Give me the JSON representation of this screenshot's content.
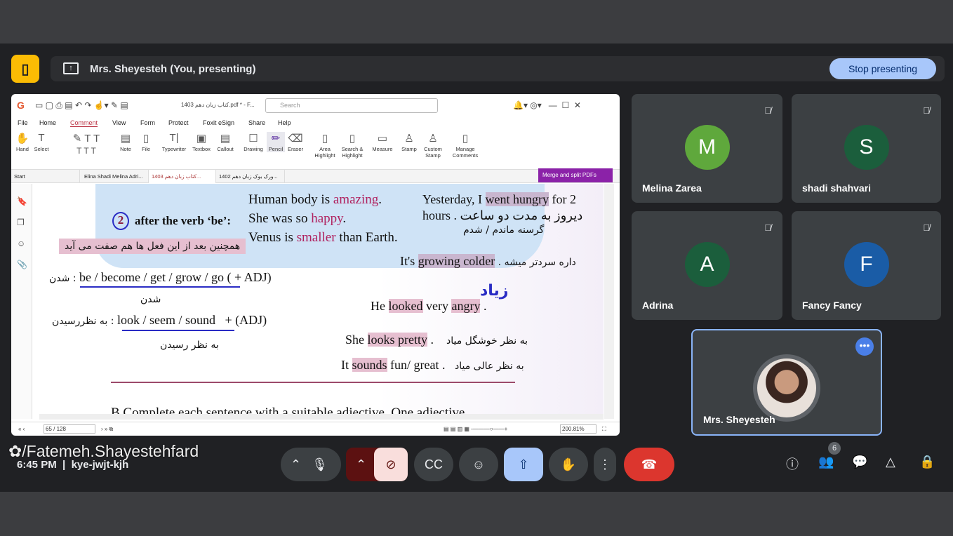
{
  "meeting": {
    "presenter_text": "Mrs. Sheyesteh (You, presenting)",
    "stop_label": "Stop presenting",
    "time": "6:45 PM",
    "code": "kye-jwjt-kjh",
    "watermark": "/Fatemeh.Shayestehfard",
    "participant_count": "6"
  },
  "pdf": {
    "title": "کتاب زبان دهم 1403.pdf * - F...",
    "search_placeholder": "Search",
    "menu": [
      "File",
      "Home",
      "Comment",
      "View",
      "Form",
      "Protect",
      "Foxit eSign",
      "Share",
      "Help"
    ],
    "tools": [
      "Hand",
      "Select",
      "Note",
      "File",
      "Typewriter",
      "Textbox",
      "Callout",
      "Drawing",
      "Pencil",
      "Eraser",
      "Area Highlight",
      "Search & Highlight",
      "Measure",
      "Stamp",
      "Custom Stamp",
      "Manage Comments"
    ],
    "tabs": [
      "Start",
      "Elina Shadi Melina Adri...",
      "کتاب زبان دهم 1403...",
      "ورک بوک زبان دهم 1402..."
    ],
    "merge_label": "Merge and split PDFs",
    "page": "65 / 128",
    "zoom": "200.81%",
    "content": {
      "heading": "after the verb ‘be’:",
      "num": "2",
      "l1a": "Human body is ",
      "l1b": "amazing",
      "l2a": "She was so ",
      "l2b": "happy",
      "l3a": "Venus is ",
      "l3b": "smaller",
      "l3c": " than Earth.",
      "fa_note": "همچنین بعد از این فعل ها هم صفت می آید",
      "r1a": "Yesterday, I ",
      "r1b": "went hungry",
      "r1c": " for 2",
      "r2": "hours .  دیروز به مدت دو ساعت",
      "r3": "گرسنه ماندم / شدم",
      "r4a": "It's ",
      "r4b": "growing colder",
      "r4c": " .  داره سردتر میشه",
      "verbs1": "be / become / get / grow / go",
      "verbs1_tail": "( + ADJ)",
      "verbs1_fa": "شدن :",
      "verbs1_under": "شدن",
      "verbs2": "look / seem / sound",
      "verbs2_tail": "+ (ADJ)",
      "verbs2_fa": "به نظررسیدن :",
      "verbs2_under": "به نظر رسیدن",
      "ex1a": "He ",
      "ex1b": "looked",
      "ex1c": " very ",
      "ex1d": "angry",
      "ex1e": " .",
      "ex2a": "She ",
      "ex2b": "looks pretty",
      "ex2c": " .",
      "ex2fa": "به نظر خوشگل میاد",
      "ex3a": "It ",
      "ex3b": "sounds",
      "ex3c": " fun/ great .",
      "ex3fa": "به نظر عالی میاد",
      "ink_word": "زیاد",
      "bottom": "B  Complete each sentence with a suitable adjective.  One adjective"
    }
  },
  "participants": [
    {
      "name": "Melina Zarea",
      "initial": "M",
      "color": "#5fa83c"
    },
    {
      "name": "shadi shahvari",
      "initial": "S",
      "color": "#1b5e3c"
    },
    {
      "name": "Adrina",
      "initial": "A",
      "color": "#1b5e3c"
    },
    {
      "name": "Fancy Fancy",
      "initial": "F",
      "color": "#1a5ca6"
    },
    {
      "name": "Mrs. Sheyesteh"
    }
  ]
}
